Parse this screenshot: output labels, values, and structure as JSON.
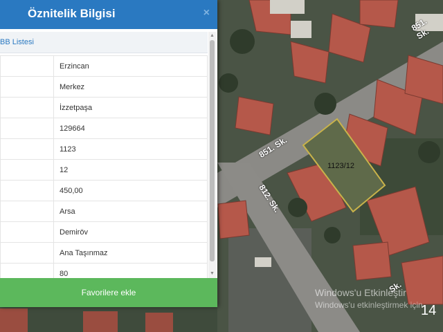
{
  "panel": {
    "title": "Öznitelik Bilgisi",
    "close_icon": "×",
    "section_title": "BB Listesi",
    "rows": [
      {
        "value": "Erzincan"
      },
      {
        "value": "Merkez"
      },
      {
        "value": "İzzetpaşa"
      },
      {
        "value": "129664"
      },
      {
        "value": "1123"
      },
      {
        "value": "12"
      },
      {
        "value": "450,00"
      },
      {
        "value": "Arsa"
      },
      {
        "value": "Demiröv"
      },
      {
        "value": "Ana Taşınmaz"
      },
      {
        "value": "80"
      }
    ],
    "favorite_button": "Favorilere ekle"
  },
  "map": {
    "street_851": "851. Sk.",
    "street_851_top": "851. Sk.",
    "street_812": "812. Sk.",
    "street_bottom": "Sk.",
    "parcel_label": "1123/12"
  },
  "overlay": {
    "watermark_title": "Windows'u Etkinleştir",
    "watermark_subtitle": "Windows'u etkinleştirmek için",
    "page_number": "14"
  },
  "colors": {
    "header_blue": "#2a79c1",
    "button_green": "#5cb85c",
    "parcel_outline": "#c9b34a"
  }
}
